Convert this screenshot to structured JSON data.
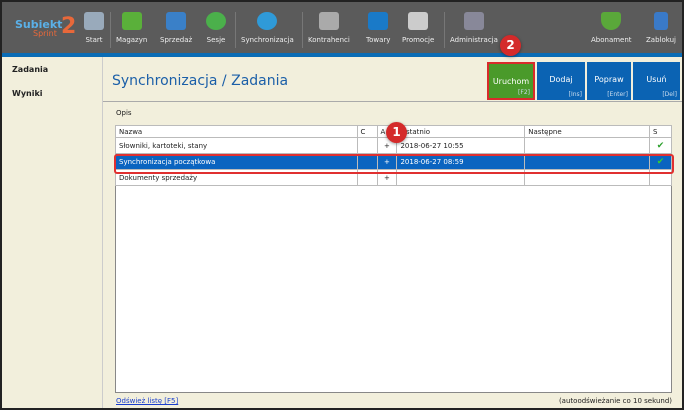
{
  "app": {
    "logo_top": "Subiekt",
    "logo_bottom": "Sprint",
    "logo_num": "2"
  },
  "toolbar": [
    {
      "label": "Start",
      "icon": "shop-icon"
    },
    {
      "label": "Magazyn",
      "icon": "warehouse-icon"
    },
    {
      "label": "Sprzedaż",
      "icon": "sales-icon"
    },
    {
      "label": "Sesje",
      "icon": "user-session-icon"
    },
    {
      "label": "Synchronizacja",
      "icon": "sync-icon"
    },
    {
      "label": "Kontrahenci",
      "icon": "contractors-icon"
    },
    {
      "label": "Towary",
      "icon": "goods-icon"
    },
    {
      "label": "Promocje",
      "icon": "promo-tag-icon"
    },
    {
      "label": "Administracja",
      "icon": "tools-icon"
    },
    {
      "label": "Abonament",
      "icon": "shield-check-icon"
    },
    {
      "label": "Zablokuj",
      "icon": "lock-icon"
    }
  ],
  "sidebar": {
    "items": [
      {
        "label": "Zadania"
      },
      {
        "label": "Wyniki"
      }
    ]
  },
  "header": {
    "title": "Synchronizacja / Zadania"
  },
  "buttons": [
    {
      "label": "Uruchom",
      "key": "[F2]"
    },
    {
      "label": "Dodaj",
      "key": "[Ins]"
    },
    {
      "label": "Popraw",
      "key": "[Enter]"
    },
    {
      "label": "Usuń",
      "key": "[Del]"
    }
  ],
  "opis_label": "Opis",
  "table": {
    "columns": [
      "Nazwa",
      "C",
      "A",
      "Ostatnio",
      "Następne",
      "S"
    ],
    "rows": [
      {
        "nazwa": "Słowniki, kartoteki, stany",
        "c": "",
        "a": "+",
        "ostatnio": "2018-06-27 10:55",
        "nastepne": "",
        "s": "✔"
      },
      {
        "nazwa": "Synchronizacja początkowa",
        "c": "",
        "a": "+",
        "ostatnio": "2018-06-27 08:59",
        "nastepne": "",
        "s": "✔"
      },
      {
        "nazwa": "Dokumenty sprzedaży",
        "c": "",
        "a": "+",
        "ostatnio": "",
        "nastepne": "",
        "s": ""
      }
    ]
  },
  "footer": {
    "refresh_link": "Odśwież listę [F5]",
    "auto_refresh": "(autoodświeżanie co 10 sekund)"
  },
  "badges": [
    "1",
    "2"
  ]
}
